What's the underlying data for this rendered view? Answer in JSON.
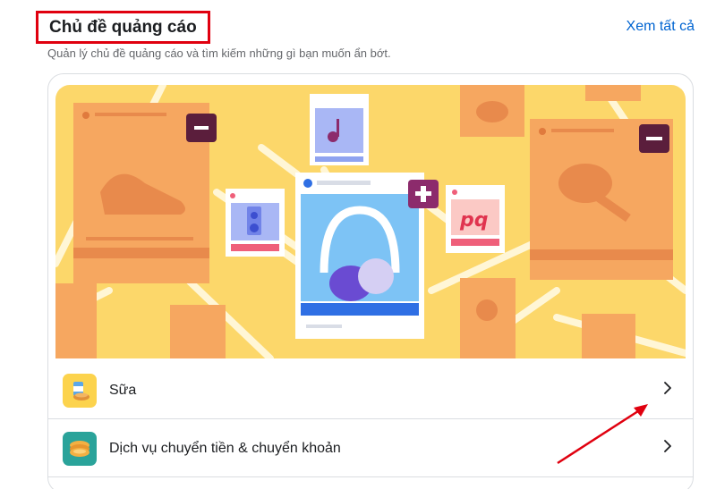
{
  "header": {
    "title": "Chủ đề quảng cáo",
    "see_all": "Xem tất cả",
    "subtitle": "Quản lý chủ đề quảng cáo và tìm kiếm những gì bạn muốn ẩn bớt."
  },
  "topics": [
    {
      "label": "Sữa",
      "icon": "milk-icon"
    },
    {
      "label": "Dịch vụ chuyển tiền & chuyển khoản",
      "icon": "money-transfer-icon"
    }
  ],
  "colors": {
    "annotation": "#e0000f",
    "link": "#0064d1",
    "hero_background": "#fcd76a"
  }
}
